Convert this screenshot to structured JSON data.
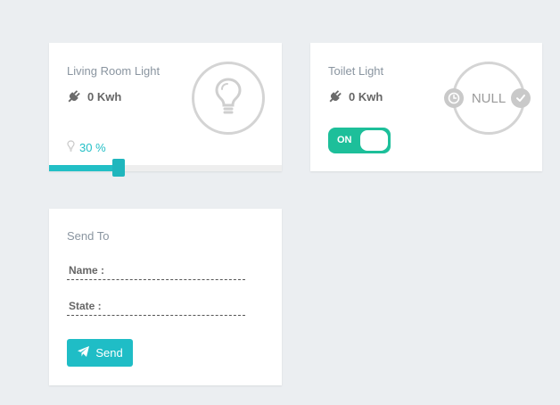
{
  "colors": {
    "accent": "#22bfc6",
    "toggle_on": "#1dbf9a",
    "muted_title": "#8a95a0",
    "circle_border": "#d4d4d4"
  },
  "living_room": {
    "title": "Living Room Light",
    "energy": "0 Kwh",
    "brightness_label": "30 %",
    "brightness_level": 0.3,
    "icons": [
      "plug-icon",
      "bulb-icon",
      "small-bulb-icon"
    ]
  },
  "toilet": {
    "title": "Toilet Light",
    "energy": "0 Kwh",
    "toggle_label": "ON",
    "toggle_state": true,
    "status": "NULL",
    "icons": [
      "plug-icon",
      "clock-icon",
      "check-icon"
    ]
  },
  "send_card": {
    "title": "Send To",
    "name_label": "Name :",
    "state_label": "State :",
    "button_label": "Send",
    "icons": [
      "paper-plane-icon"
    ]
  }
}
